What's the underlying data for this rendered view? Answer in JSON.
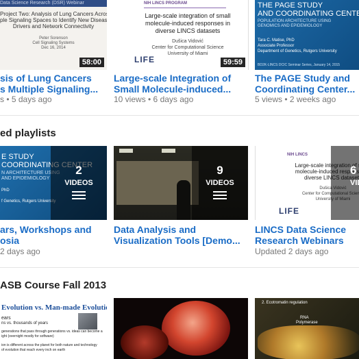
{
  "row1": {
    "videos": [
      {
        "title_line1": "sis of Lung Cancers",
        "title_line2": "s Multiple Signaling...",
        "meta": "s • 5 days ago",
        "duration": "58:00",
        "thumb_lines": [
          "Project Two: Analysis of Lung Cancers Across",
          "ple Signaling Spaces to Identify New Disease",
          "Drivers and Network Connectivity",
          "Peter Sorenson",
          "Cell Signaling Systems",
          "Dec 16, 2014"
        ],
        "thumb_header": "Data Science Research (DSR) Webinar"
      },
      {
        "title_line1": "Large-scale Integration of",
        "title_line2": "Small Molecule-induced...",
        "meta": "10 views • 6 days ago",
        "duration": "59:59",
        "thumb_lines": [
          "Large-scale integration of small",
          "molecule-induced responses in",
          "diverse LINCS datasets",
          "Dušica Vidović",
          "Center for Computational Science",
          "University of Miami"
        ],
        "thumb_logo": "LIFE",
        "thumb_header": "NIH LINCS PROGRAM"
      },
      {
        "title_line1": "The PAGE Study and",
        "title_line2": "Coordinating Center...",
        "meta": "5 views • 2 weeks ago",
        "thumb_lines": [
          "THE PAGE STUDY",
          "AND COORDINATING CENTER",
          "POPULATION ARCHITECTURE USING",
          "GENOMICS AND EPIDEMIOLOGY",
          "Tara C. Matise, PhD",
          "Associate Professor",
          "Department of Genetics, Rutgers University"
        ],
        "thumb_footer": "BD2K-LINCS DCIC Seminar Series, January 14, 2015"
      }
    ]
  },
  "playlists_section": {
    "title": "ed playlists",
    "videos_label": "VIDEOS",
    "items": [
      {
        "title_line1": "ars, Workshops and",
        "title_line2": "osia",
        "meta": "2 days ago",
        "count": "2",
        "thumb_lines": [
          "E STUDY",
          "COORDINATING CENTER",
          "N ARCHITECTURE USING",
          "AND EPIDEMIOLOGY",
          "PhD",
          "f Genetics, Rutgers University"
        ]
      },
      {
        "title_line1": "Data Analysis and",
        "title_line2": "Visualization Tools [Demo...",
        "meta": "",
        "count": "9"
      },
      {
        "title_line1": "LINCS Data Science",
        "title_line2": "Research Webinars",
        "meta": "Updated 2 days ago",
        "count": "6",
        "thumb_lines": [
          "Large-scale integration of small",
          "molecule-induced responses in",
          "diverse LINCS datasets",
          "Dušica Vidović",
          "Center for Computational Science",
          "University of Miami"
        ],
        "thumb_logo": "LIFE",
        "thumb_header": "NIH LINCS"
      }
    ]
  },
  "course_section": {
    "title": "ASB Course Fall 2013",
    "items": [
      {
        "thumb_title": "Evolution vs. Man-made Evolution",
        "thumb_lines": [
          "ears",
          "ns vs. thousands of years",
          "generations that pass through generations vs. ideas can become a",
          "ight (overnight mostly for software)",
          "ion is different across the planet for both nature and technology",
          "of evolution that reach every inch on earth"
        ]
      },
      {
        "thumb_title": ""
      },
      {
        "thumb_title": "2. Ecotromatin regulation",
        "thumb_lines": [
          "RNA",
          "Polymerase"
        ]
      }
    ]
  }
}
